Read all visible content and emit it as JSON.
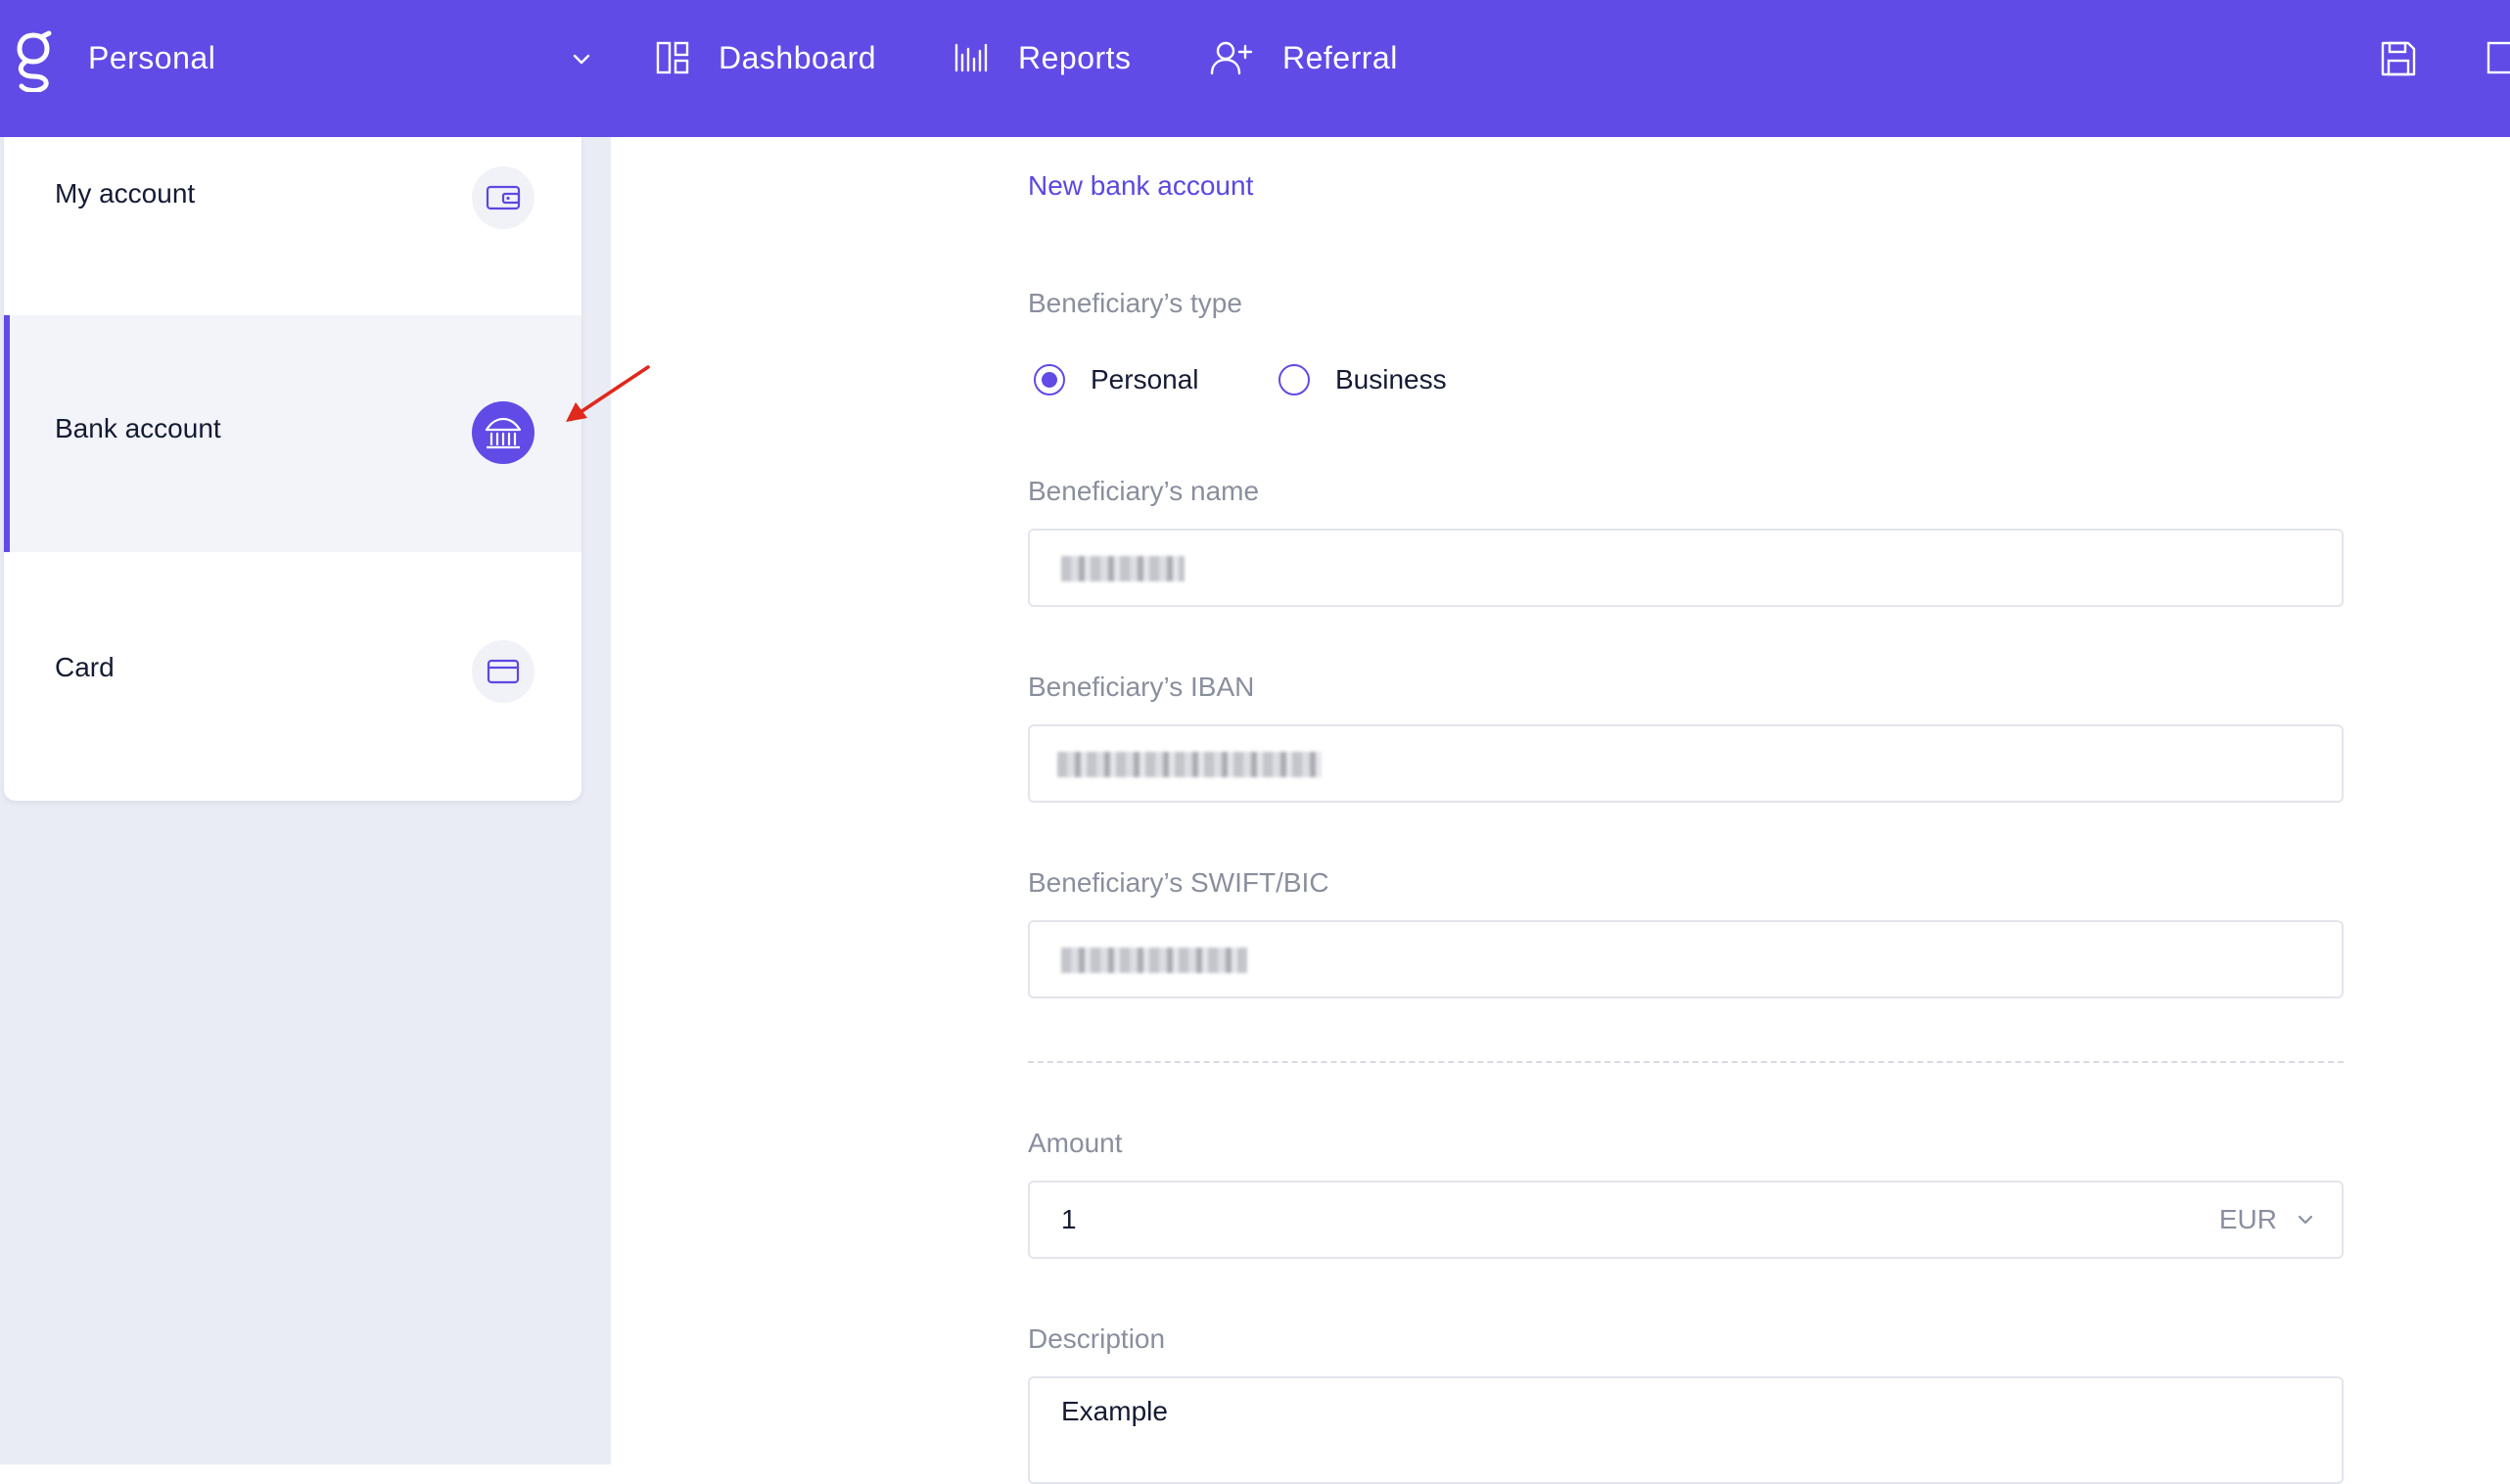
{
  "app": {
    "account_label": "Personal",
    "accent_color": "#604be6"
  },
  "nav": {
    "dashboard": "Dashboard",
    "reports": "Reports",
    "referral": "Referral"
  },
  "sidebar": {
    "items": [
      {
        "label": "My account",
        "icon": "wallet-icon"
      },
      {
        "label": "Bank account",
        "icon": "bank-icon",
        "active": true
      },
      {
        "label": "Card",
        "icon": "credit-card-icon"
      }
    ]
  },
  "form": {
    "title": "New bank account",
    "beneficiary_type": {
      "label": "Beneficiary’s type",
      "options": [
        "Personal",
        "Business"
      ],
      "selected": "Personal"
    },
    "name_label": "Beneficiary’s name",
    "iban_label": "Beneficiary’s IBAN",
    "swift_label": "Beneficiary’s SWIFT/BIC",
    "amount_label": "Amount",
    "amount_value": "1",
    "currency": "EUR",
    "description_label": "Description",
    "description_value": "Example"
  }
}
